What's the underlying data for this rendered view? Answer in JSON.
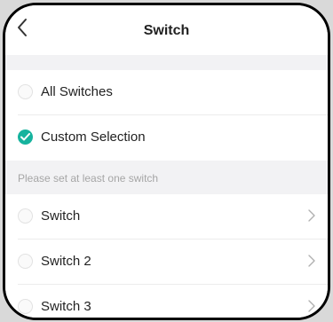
{
  "header": {
    "title": "Switch",
    "back_icon": "chevron-left-icon"
  },
  "scope_options": [
    {
      "label": "All Switches",
      "selected": false
    },
    {
      "label": "Custom Selection",
      "selected": true
    }
  ],
  "hint": "Please set at least one switch",
  "switches": [
    {
      "label": "Switch",
      "selected": false
    },
    {
      "label": "Switch 2",
      "selected": false
    },
    {
      "label": "Switch 3",
      "selected": false
    }
  ],
  "colors": {
    "accent": "#16b39e",
    "section_bg": "#f2f2f4",
    "hint_text": "#a6a6a6"
  }
}
